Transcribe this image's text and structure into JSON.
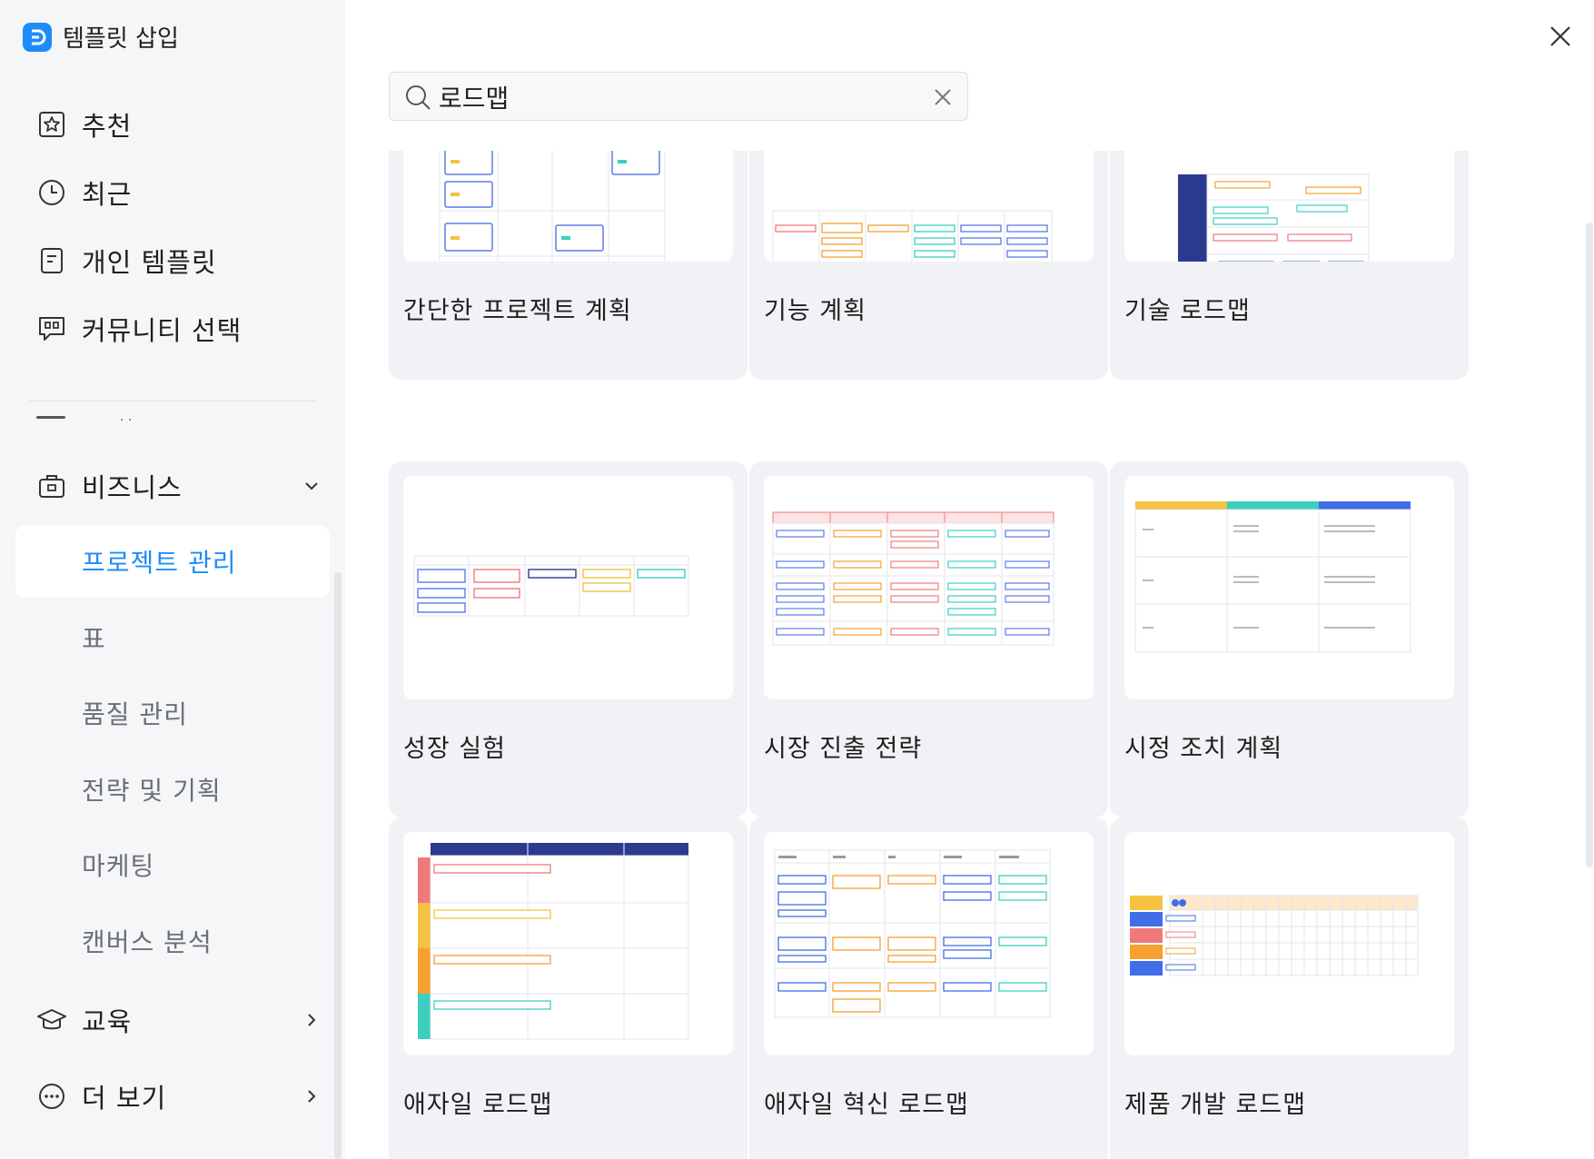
{
  "app": {
    "title": "템플릿 삽입"
  },
  "sidebar": {
    "nav": [
      {
        "label": "추천",
        "icon": "star-icon"
      },
      {
        "label": "최근",
        "icon": "clock-icon"
      },
      {
        "label": "개인 템플릿",
        "icon": "document-icon"
      },
      {
        "label": "커뮤니티 선택",
        "icon": "chat-icon"
      }
    ],
    "business": {
      "label": "비즈니스",
      "icon": "briefcase-icon",
      "expanded": true
    },
    "business_sub": [
      {
        "label": "프로젝트 관리",
        "active": true
      },
      {
        "label": "표"
      },
      {
        "label": "품질 관리"
      },
      {
        "label": "전략 및 기획"
      },
      {
        "label": "마케팅"
      },
      {
        "label": "캔버스 분석"
      }
    ],
    "education": {
      "label": "교육",
      "icon": "graduation-cap-icon"
    },
    "more": {
      "label": "더 보기",
      "icon": "more-icon"
    }
  },
  "search": {
    "value": "로드맵"
  },
  "templates": [
    {
      "title": "간단한 프로젝트 계획"
    },
    {
      "title": "기능 계획"
    },
    {
      "title": "기술 로드맵"
    },
    {
      "title": "성장 실험"
    },
    {
      "title": "시장 진출 전략"
    },
    {
      "title": "시정 조치 계획"
    },
    {
      "title": "애자일 로드맵"
    },
    {
      "title": "애자일 혁신 로드맵"
    },
    {
      "title": "제품 개발 로드맵"
    }
  ],
  "colors": {
    "accent": "#1d8cf8",
    "sidebar_bg": "#f5f6f8",
    "card_bg": "#f1f2f5",
    "navy": "#2b3a8f",
    "yellow": "#f5c242",
    "teal": "#3ccfc0",
    "blue": "#3f6ee8",
    "red": "#f07a7a",
    "orange": "#f5a030"
  }
}
